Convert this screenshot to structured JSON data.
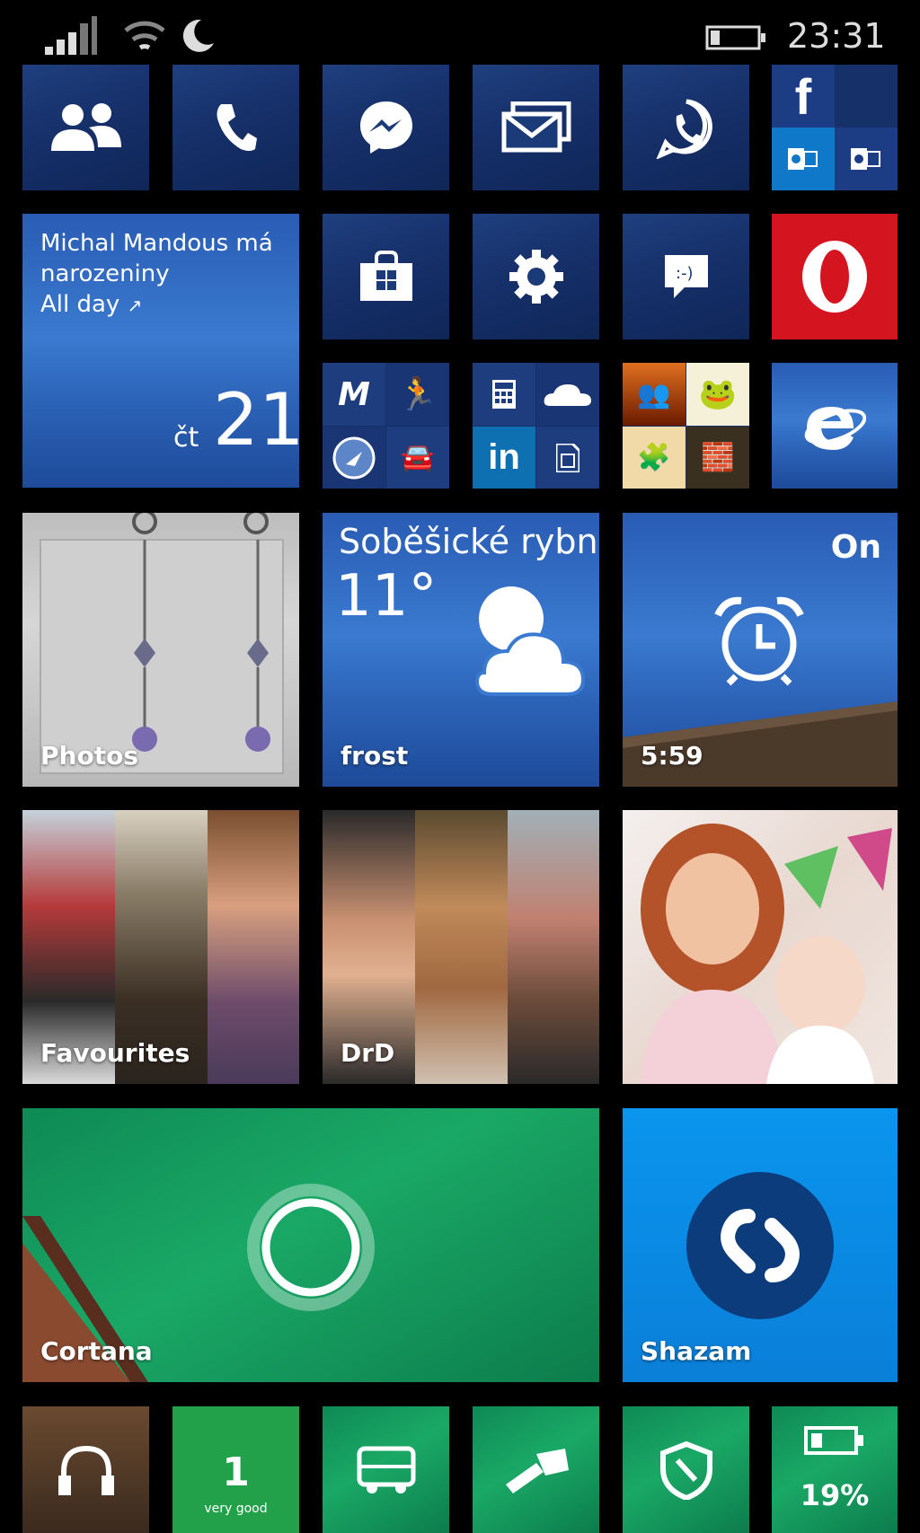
{
  "status_bar": {
    "time": "23:31"
  },
  "calendar": {
    "line1": "Michal Mandous má",
    "line2": "narozeniny",
    "line3": "All day",
    "weekday": "čt",
    "day": "21"
  },
  "weather": {
    "location": "Soběšické rybní",
    "temperature": "11°",
    "condition": "frost"
  },
  "alarm": {
    "state": "On",
    "time": "5:59"
  },
  "tiles": {
    "photos": "Photos",
    "favourites": "Favourites",
    "drd": "DrD",
    "cortana": "Cortana",
    "shazam": "Shazam"
  },
  "bottom": {
    "rating_value": "1",
    "rating_text": "very good",
    "battery_percent": "19%"
  },
  "icons": [
    "people-icon",
    "phone-icon",
    "messenger-icon",
    "mail-icon",
    "whatsapp-icon",
    "facebook-icon",
    "outlook-icon",
    "store-icon",
    "settings-icon",
    "feedback-icon",
    "opera-icon",
    "ie-icon",
    "alarm-clock-icon",
    "weather-icon",
    "cortana-icon",
    "shazam-icon",
    "music-icon",
    "torch-icon",
    "shield-icon",
    "battery-icon",
    "linkedin-icon",
    "onedrive-icon",
    "calculator-icon"
  ],
  "colors": {
    "tile_blue": "#16306a",
    "opera_red": "#d4151f",
    "shazam_blue": "#0a87e0",
    "tile_green": "#1aa866"
  }
}
